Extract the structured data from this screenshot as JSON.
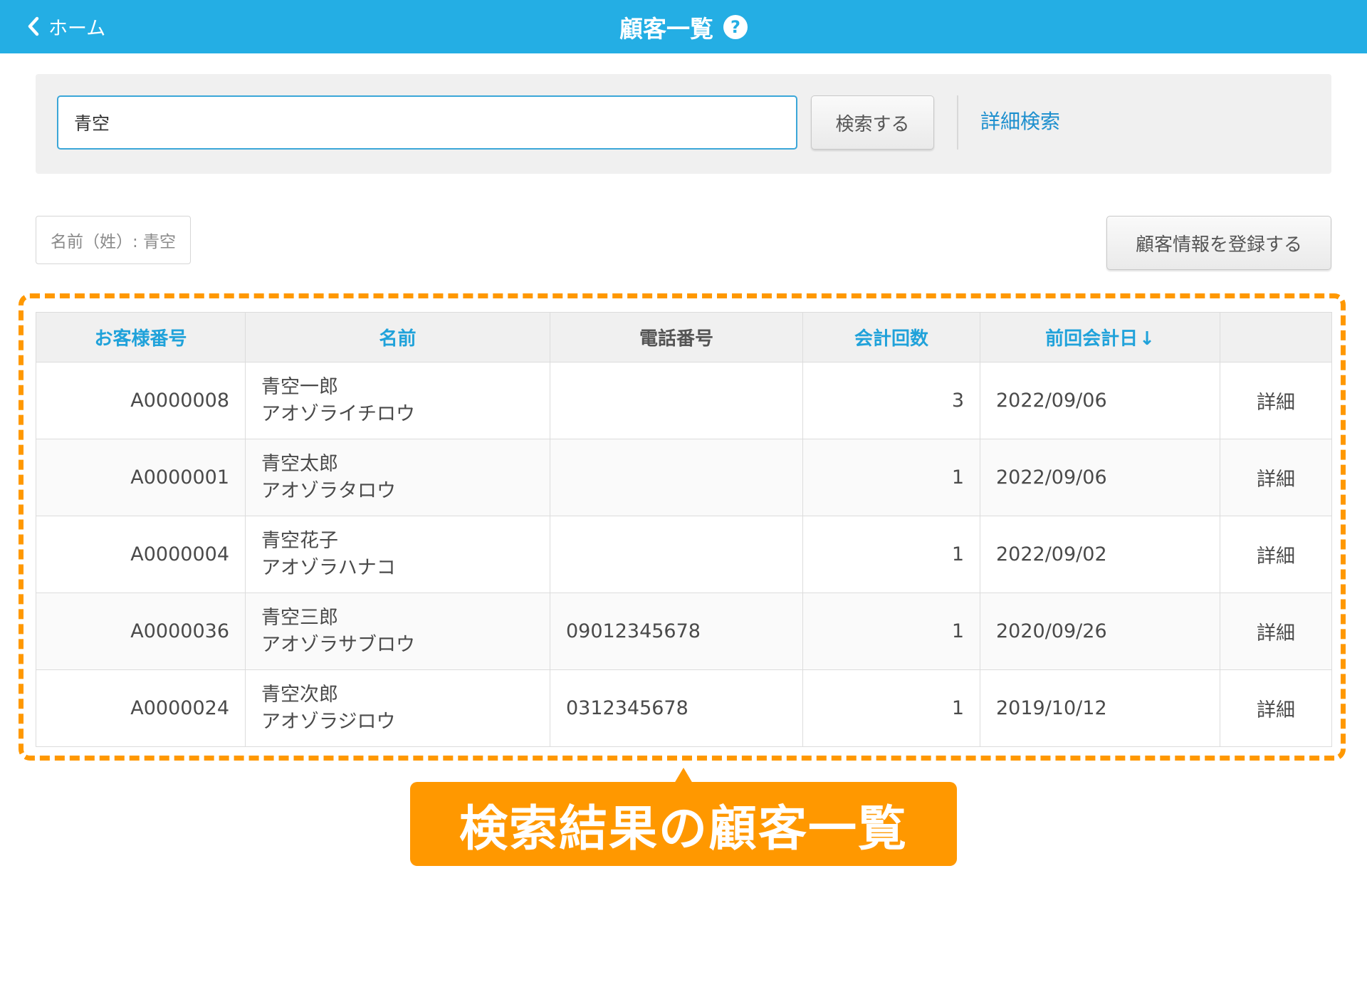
{
  "colors": {
    "header": "#24aee4",
    "link": "#1d8fce",
    "accent": "#ff9800"
  },
  "header": {
    "back_label": "ホーム",
    "back_icon": "chevron-left-icon",
    "title": "顧客一覧",
    "help_icon": "?"
  },
  "search": {
    "value": "青空",
    "button_label": "検索する",
    "detail_link": "詳細検索"
  },
  "filter": {
    "chip_label": "名前（姓）: 青空"
  },
  "actions": {
    "register_label": "顧客情報を登録する"
  },
  "table": {
    "headers": {
      "id": "お客様番号",
      "name": "名前",
      "phone": "電話番号",
      "visits": "会計回数",
      "last_date": "前回会計日",
      "sort_arrow": "↓"
    },
    "rows": [
      {
        "id": "A0000008",
        "name": "青空一郎",
        "kana": "アオゾライチロウ",
        "phone": "",
        "visits": "3",
        "last_date": "2022/09/06",
        "action": "詳細"
      },
      {
        "id": "A0000001",
        "name": "青空太郎",
        "kana": "アオゾラタロウ",
        "phone": "",
        "visits": "1",
        "last_date": "2022/09/06",
        "action": "詳細"
      },
      {
        "id": "A0000004",
        "name": "青空花子",
        "kana": "アオゾラハナコ",
        "phone": "",
        "visits": "1",
        "last_date": "2022/09/02",
        "action": "詳細"
      },
      {
        "id": "A0000036",
        "name": "青空三郎",
        "kana": "アオゾラサブロウ",
        "phone": "09012345678",
        "visits": "1",
        "last_date": "2020/09/26",
        "action": "詳細"
      },
      {
        "id": "A0000024",
        "name": "青空次郎",
        "kana": "アオゾラジロウ",
        "phone": "0312345678",
        "visits": "1",
        "last_date": "2019/10/12",
        "action": "詳細"
      }
    ]
  },
  "annotation": {
    "label": "検索結果の顧客一覧"
  }
}
